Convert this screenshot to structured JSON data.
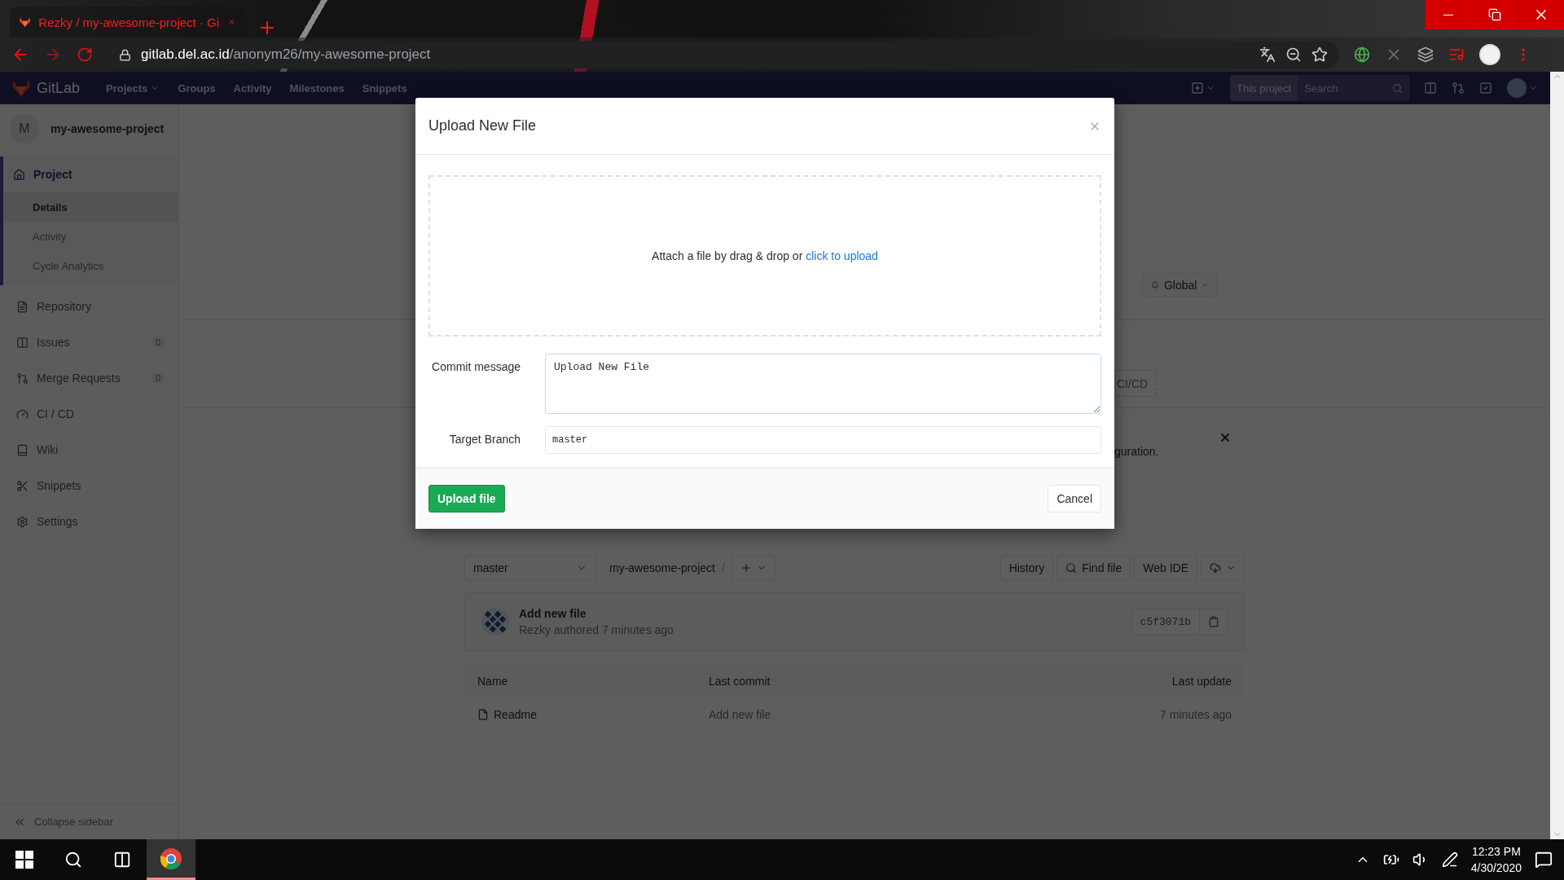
{
  "browser": {
    "tab": {
      "title": "Rezky / my-awesome-project · Gi"
    },
    "url": {
      "host": "gitlab.del.ac.id",
      "path": "/anonym26/my-awesome-project"
    }
  },
  "navbar": {
    "brand": "GitLab",
    "links": [
      {
        "label": "Projects",
        "dropdown": true
      },
      {
        "label": "Groups",
        "dropdown": false
      },
      {
        "label": "Activity",
        "dropdown": false
      },
      {
        "label": "Milestones",
        "dropdown": false
      },
      {
        "label": "Snippets",
        "dropdown": false
      }
    ],
    "search": {
      "scope": "This project",
      "placeholder": "Search"
    }
  },
  "sidebar": {
    "project_initial": "M",
    "project_name": "my-awesome-project",
    "items": [
      {
        "label": "Project",
        "selected": true,
        "children": [
          {
            "label": "Details",
            "selected": true
          },
          {
            "label": "Activity",
            "selected": false
          },
          {
            "label": "Cycle Analytics",
            "selected": false
          }
        ]
      },
      {
        "label": "Repository",
        "selected": false
      },
      {
        "label": "Issues",
        "selected": false,
        "count": "0"
      },
      {
        "label": "Merge Requests",
        "selected": false,
        "count": "0"
      },
      {
        "label": "CI / CD",
        "selected": false
      },
      {
        "label": "Wiki",
        "selected": false
      },
      {
        "label": "Snippets",
        "selected": false
      },
      {
        "label": "Settings",
        "selected": false
      }
    ],
    "collapse": "Collapse sidebar"
  },
  "project_header": {
    "notification_button": "Global",
    "ci_cd_button": "CI/CD",
    "alert_text": "guration."
  },
  "repo": {
    "branch": "master",
    "path": "my-awesome-project",
    "separator": "/",
    "buttons": [
      "History",
      "Find file",
      "Web IDE"
    ]
  },
  "last_commit": {
    "title": "Add new file",
    "meta": "Rezky authored 7 minutes ago",
    "sha": "c5f3071b"
  },
  "files": {
    "columns": [
      "Name",
      "Last commit",
      "Last update"
    ],
    "rows": [
      {
        "name": "Readme",
        "last_commit": "Add new file",
        "last_update": "7 minutes ago"
      }
    ]
  },
  "modal": {
    "title": "Upload New File",
    "dropzone": {
      "text": "Attach a file by drag & drop or ",
      "link": "click to upload"
    },
    "fields": [
      {
        "label": "Commit message",
        "kind": "textarea",
        "value": "Upload New File"
      },
      {
        "label": "Target Branch",
        "kind": "input",
        "value": "master"
      }
    ],
    "primary_button": "Upload file",
    "cancel_button": "Cancel"
  },
  "taskbar": {
    "time": "12:23 PM",
    "date": "4/30/2020"
  }
}
